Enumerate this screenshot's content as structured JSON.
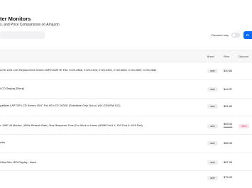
{
  "header": {
    "title": "ter Monitors",
    "subtitle": "s, and Price Comparisons on Amazon",
    "discount_only_label": "Discount only",
    "primary_button_label": "Pl"
  },
  "table": {
    "columns": [
      "Brand",
      "Price",
      "Discount"
    ],
    "rows": [
      {
        "name": "A HD LED LCD Replacement Screen 30PIN MATTE Fits: C720-2848, C720-2103, C720-3403, C720-3605, C720-2802, C720-2844",
        "brand": "acer",
        "price": "$30.84",
        "old_price": "",
        "discount": ""
      },
      {
        "name": "LCD Display (Black)",
        "brand": "acer",
        "price": "$44.37",
        "old_price": "",
        "discount": ""
      },
      {
        "name": "patibles LAPTOP LCD Screen 15.6\" Full HD LED DIODE (Substitute Only. Not a ) (NX.GDWSW.012)",
        "brand": "acer",
        "price": "$51.60",
        "old_price": "",
        "discount": ""
      },
      {
        "name": "x 1080 VA Monitor | 60Hz Refresh Rate | 5ms Response Time (For Work or Home (HDMI Port1.4, DVI Port & VGA Port)",
        "brand": "acer",
        "price": "$55.00",
        "old_price": "$149.99",
        "discount": "-63%"
      },
      {
        "name": "nitor",
        "brand": "acer",
        "price": "$58.43",
        "old_price": "",
        "discount": ""
      },
      {
        "name": "Ultra-Slim LED Display - black",
        "brand": "acer",
        "price": "$67.99",
        "old_price": "",
        "discount": ""
      },
      {
        "name": "",
        "brand": "acer",
        "price": "$75.00",
        "old_price": "",
        "discount": ""
      }
    ]
  }
}
